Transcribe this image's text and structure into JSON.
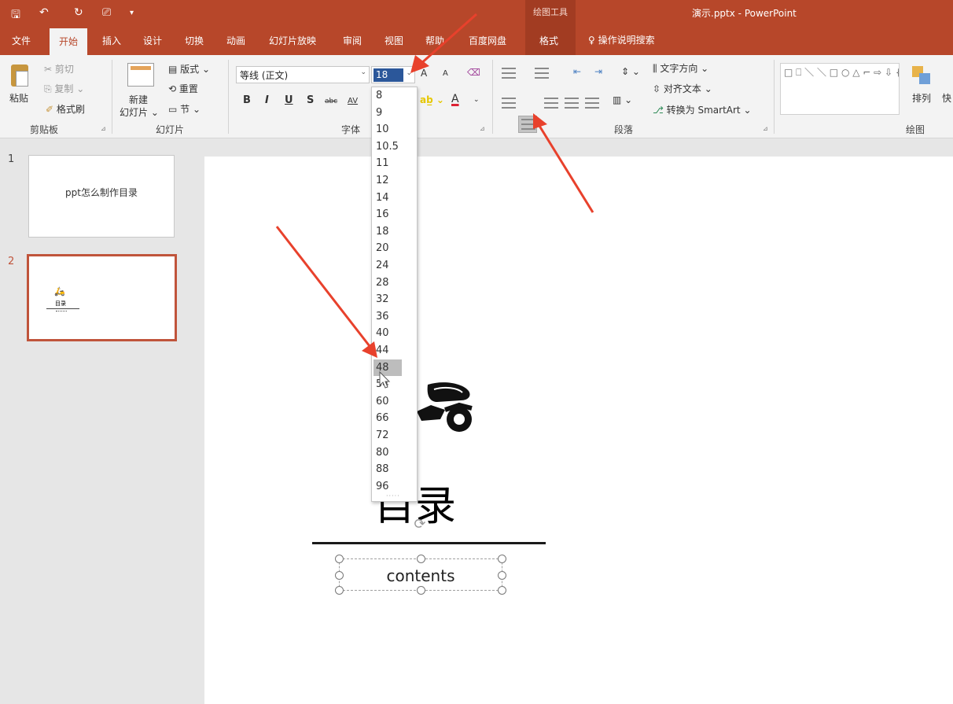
{
  "titlebar": {
    "quick_access": [
      "🖫",
      "↶",
      "↻",
      "⎚",
      "▾"
    ],
    "context_tools": "绘图工具",
    "title": "演示.pptx  -  PowerPoint"
  },
  "tabs": [
    "文件",
    "开始",
    "插入",
    "设计",
    "切换",
    "动画",
    "幻灯片放映",
    "审阅",
    "视图",
    "帮助",
    "百度网盘",
    "格式"
  ],
  "active_tab": "开始",
  "search_tab": "操作说明搜索",
  "clipboard": {
    "paste": "粘贴",
    "cut": "剪切",
    "copy": "复制",
    "format_painter": "格式刷",
    "label": "剪贴板"
  },
  "slides_group": {
    "new_slide_1": "新建",
    "new_slide_2": "幻灯片",
    "layout": "版式",
    "reset": "重置",
    "section": "节",
    "label": "幻灯片"
  },
  "font_group": {
    "font_name": "等线 (正文)",
    "font_size": "18",
    "bold": "B",
    "italic": "I",
    "underline": "U",
    "strike": "S",
    "abc": "abc",
    "spacing": "AV",
    "grow": "A",
    "shrink": "A",
    "font_color": "A",
    "label": "字体"
  },
  "paragraph_group": {
    "text_direction": "文字方向",
    "align_text": "对齐文本",
    "smartart": "转换为 SmartArt",
    "label": "段落"
  },
  "drawing_group": {
    "shapes": "□ ⎕ ＼ ＼ □ ○ △ ⌐ ⇨ ⇩ { }",
    "arrange": "排列",
    "quick_styles": "快",
    "label": "绘图"
  },
  "thumbnails": [
    {
      "number": "1",
      "title": "ppt怎么制作目录"
    },
    {
      "number": "2",
      "mini_title": "目录"
    }
  ],
  "slide": {
    "title": "目录",
    "subtitle": "contents"
  },
  "font_size_options": [
    "8",
    "9",
    "10",
    "10.5",
    "11",
    "12",
    "14",
    "16",
    "18",
    "20",
    "24",
    "28",
    "32",
    "36",
    "40",
    "44",
    "48",
    "54",
    "60",
    "66",
    "72",
    "80",
    "88",
    "96"
  ],
  "highlighted_size": "48",
  "colors": {
    "ribbon_accent": "#b7472a",
    "annotation_arrow": "#e8412c",
    "selection": "#2b579a"
  }
}
